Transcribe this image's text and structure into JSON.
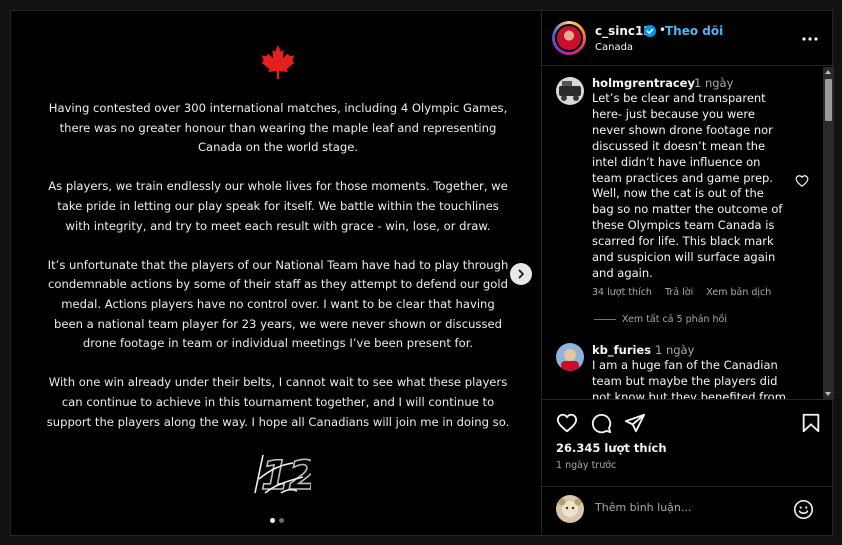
{
  "post": {
    "username": "c_sinc12",
    "separator": "•",
    "follow_label": "Theo dõi",
    "location": "Canada",
    "likes": "26.345 lượt thích",
    "posted_ago": "1 ngày trước",
    "add_comment_placeholder": "Thêm bình luận...",
    "carousel_count": 2,
    "carousel_active": 1
  },
  "media": {
    "paragraphs": [
      "Having contested over 300 international matches, including 4 Olympic Games, there was no greater honour than wearing the maple leaf and representing Canada on the world stage.",
      "As players, we train endlessly our whole lives for those moments. Together, we take pride in letting our play speak for itself. We battle within the touchlines with integrity, and try to meet each result with grace - win, lose, or draw.",
      "It’s unfortunate that the players of our National Team have had to play through condemnable actions by some of their staff as they attempt to defend our gold medal. Actions players have no control over. I want to be clear that having been a national team player for 23 years, we were never shown or discussed drone footage in team or individual meetings I’ve been present for.",
      "With one win already under their belts, I cannot wait to see what these players can continue to achieve in this tournament together, and I will continue to support the players along the way. I hope all Canadians will join me in doing so."
    ],
    "signature_text": "12"
  },
  "comments": [
    {
      "username": "holmgrentracey",
      "time": "1 ngày",
      "text": "Let’s be clear and transparent here- just because you were never shown drone footage nor discussed it doesn’t mean the intel didn’t have influence on team practices and game prep. Well, now the cat is out of the bag so no matter the outcome of these Olympics team Canada is scarred for life. This black mark and suspicion will surface again and again.",
      "likes": "34 lượt thích",
      "reply": "Trả lời",
      "translate": "Xem bản dịch",
      "view_replies": "Xem tất cả 5 phản hồi"
    },
    {
      "username": "kb_furies",
      "time": "1 ngày",
      "text": "I am a huge fan of the Canadian team but maybe the players did not know but they benefited from the"
    }
  ],
  "icons": {
    "maple_leaf_color": "#e4211f",
    "verified_color": "#0095f6",
    "follow_color": "#4cb5f9"
  }
}
